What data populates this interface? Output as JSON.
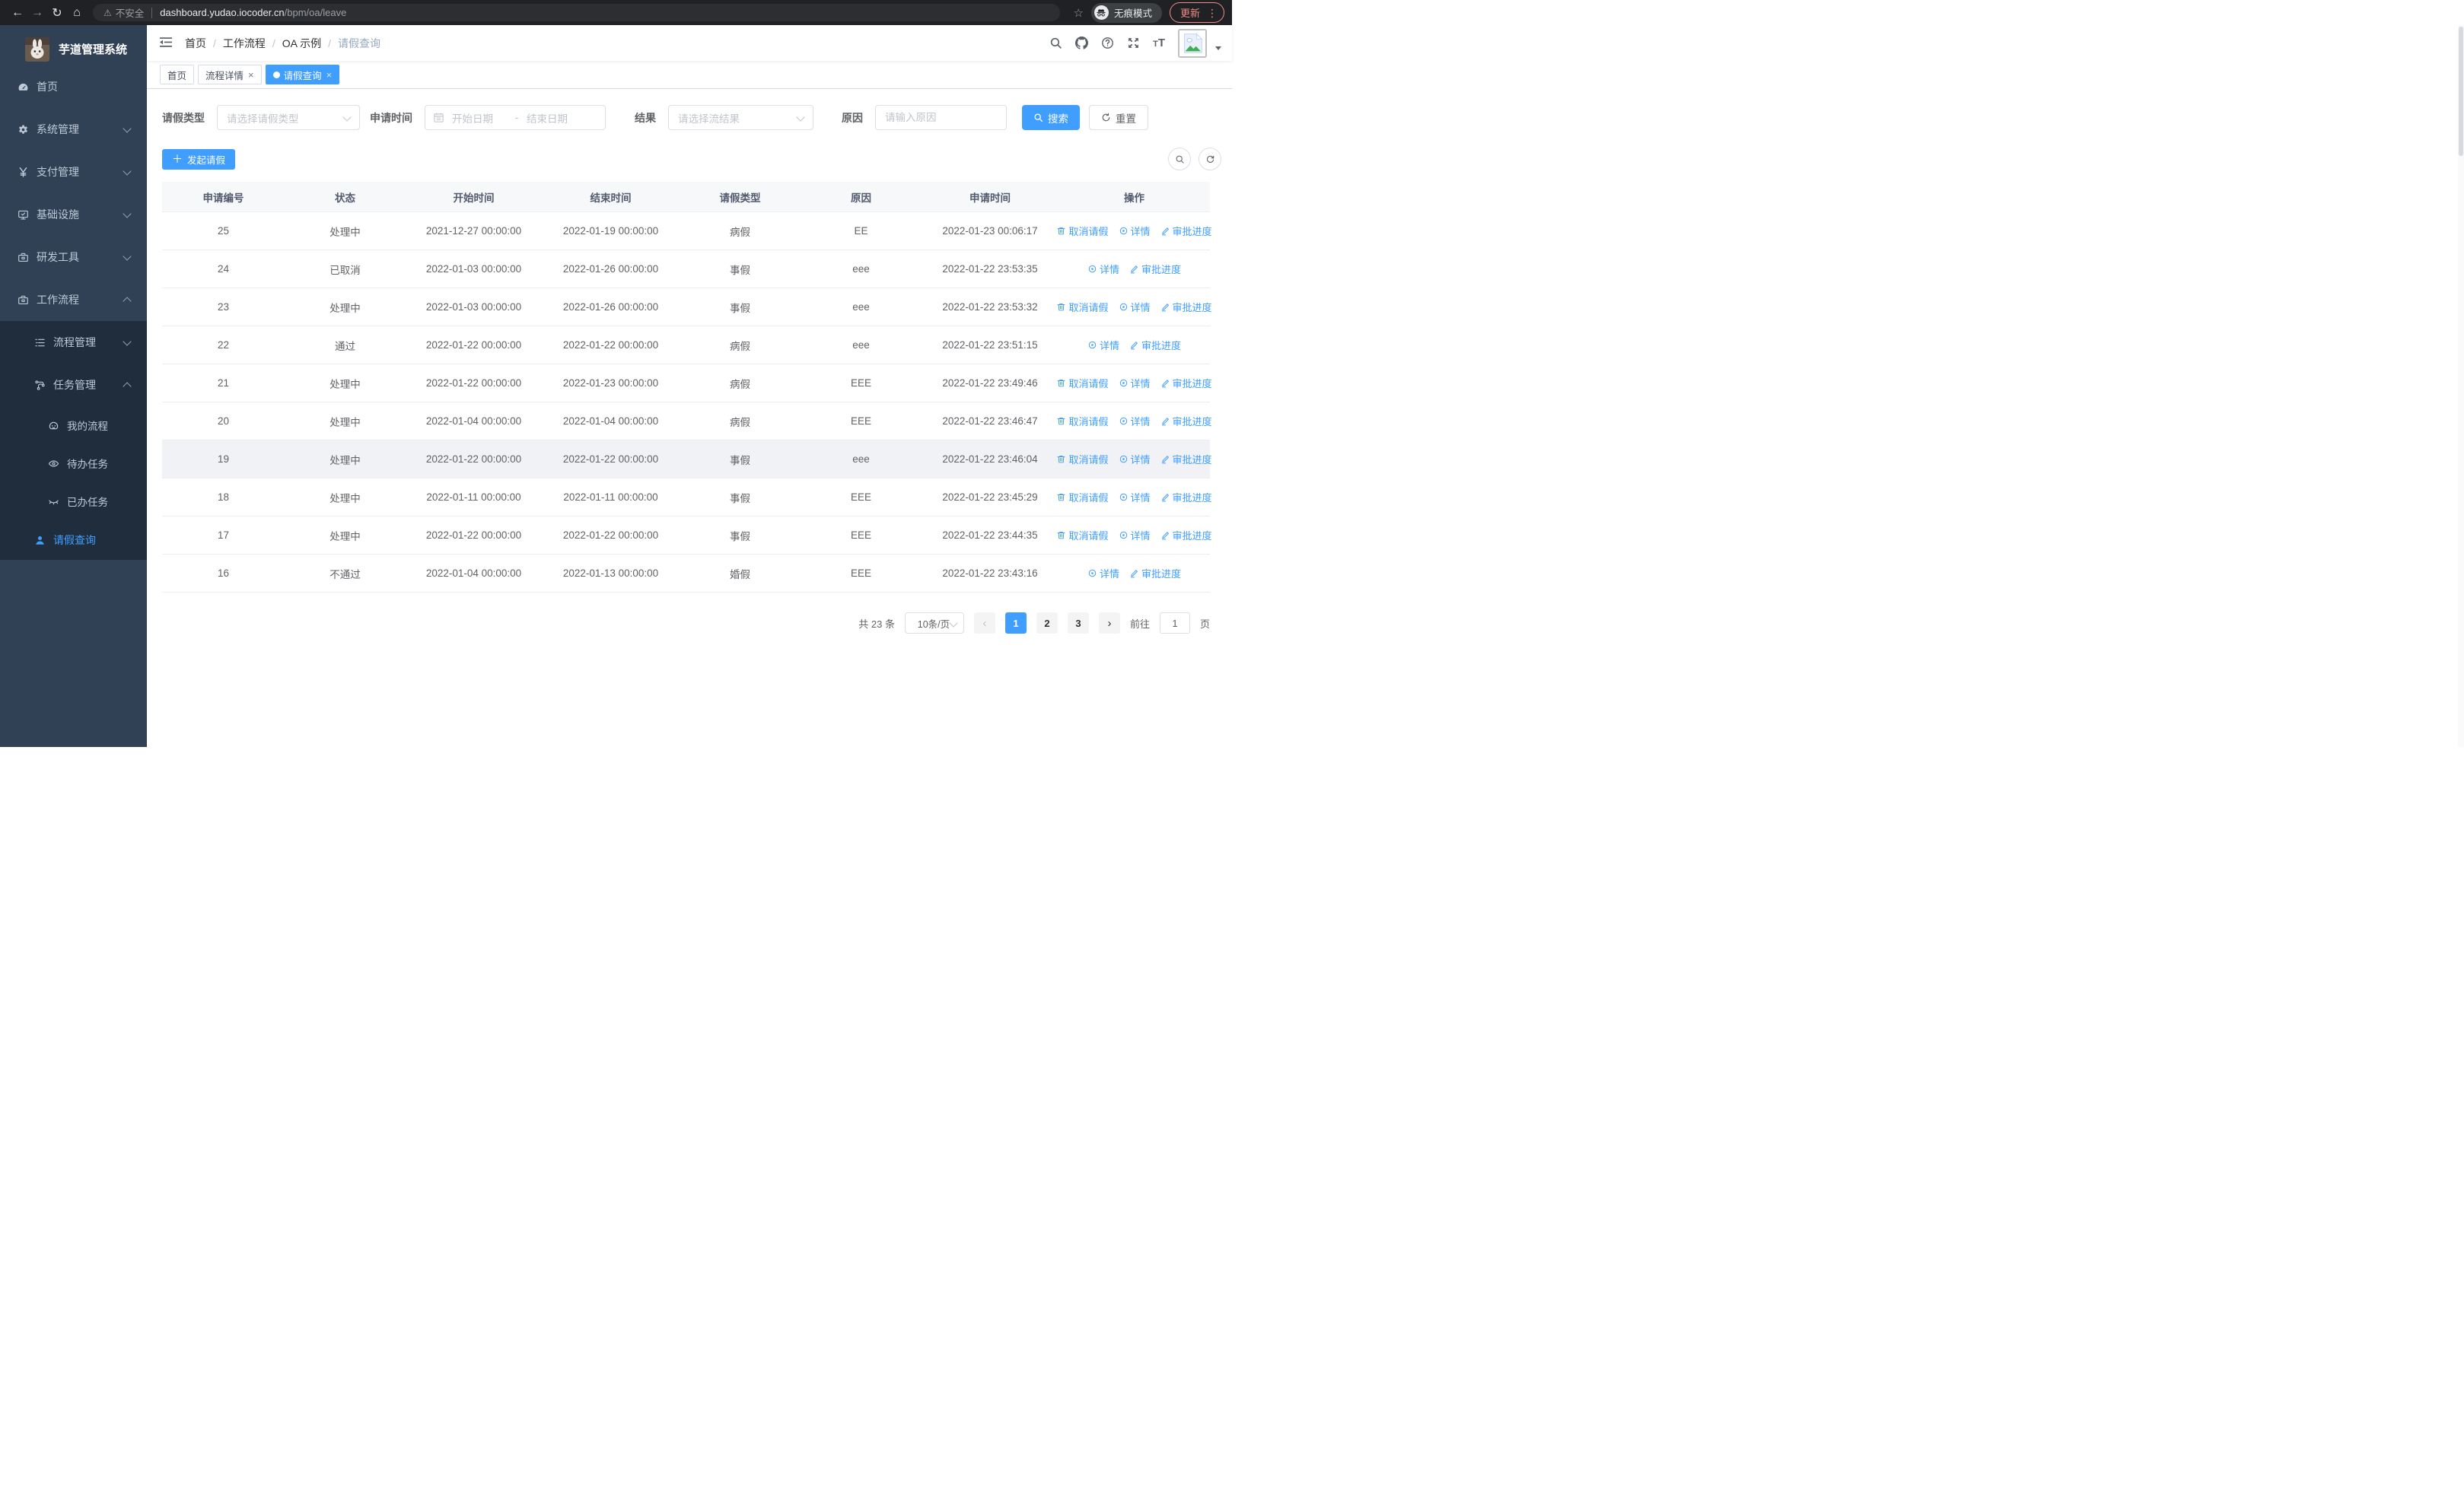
{
  "colors": {
    "accent": "#409eff",
    "sidebar_bg": "#304156",
    "submenu_bg": "#1f2d3d",
    "update": "#f28b82"
  },
  "browser": {
    "security_label": "不安全",
    "url_host": "dashboard.yudao.iocoder.cn",
    "url_path": "/bpm/oa/leave",
    "incognito_label": "无痕模式",
    "update_label": "更新"
  },
  "sidebar": {
    "title": "芋道管理系统",
    "menu": [
      {
        "key": "home",
        "label": "首页",
        "icon": "dashboard-icon",
        "level": 1
      },
      {
        "key": "system",
        "label": "系统管理",
        "icon": "gear-icon",
        "level": 1,
        "chevron": "down"
      },
      {
        "key": "payment",
        "label": "支付管理",
        "icon": "yen-icon",
        "level": 1,
        "chevron": "down"
      },
      {
        "key": "infrastructure",
        "label": "基础设施",
        "icon": "monitor-icon",
        "level": 1,
        "chevron": "down"
      },
      {
        "key": "dev-tools",
        "label": "研发工具",
        "icon": "toolbox-icon",
        "level": 1,
        "chevron": "down"
      },
      {
        "key": "workflow",
        "label": "工作流程",
        "icon": "workflow-icon",
        "level": 1,
        "chevron": "up"
      },
      {
        "key": "process-mgmt",
        "label": "流程管理",
        "icon": "list-icon",
        "level": 2,
        "chevron": "down",
        "submenu": true
      },
      {
        "key": "task-mgmt",
        "label": "任务管理",
        "icon": "branch-icon",
        "level": 2,
        "chevron": "up",
        "submenu": true
      },
      {
        "key": "my-process",
        "label": "我的流程",
        "icon": "robot-icon",
        "level": 3,
        "submenu": true
      },
      {
        "key": "todo-tasks",
        "label": "待办任务",
        "icon": "eye-icon",
        "level": 3,
        "submenu": true
      },
      {
        "key": "done-tasks",
        "label": "已办任务",
        "icon": "eye-closed-icon",
        "level": 3,
        "submenu": true
      },
      {
        "key": "leave-query",
        "label": "请假查询",
        "icon": "user-icon",
        "level": 2,
        "submenu": true,
        "active": true,
        "h52": true
      }
    ]
  },
  "header": {
    "breadcrumb": [
      "首页",
      "工作流程",
      "OA 示例",
      "请假查询"
    ],
    "icons": [
      "search-icon",
      "github-icon",
      "help-icon",
      "fullscreen-icon"
    ]
  },
  "tabs": [
    {
      "key": "home",
      "label": "首页",
      "closable": false,
      "active": false
    },
    {
      "key": "process-detail",
      "label": "流程详情",
      "closable": true,
      "active": false
    },
    {
      "key": "leave-query",
      "label": "请假查询",
      "closable": true,
      "active": true
    }
  ],
  "filters": {
    "type_label": "请假类型",
    "type_placeholder": "请选择请假类型",
    "time_label": "申请时间",
    "start_placeholder": "开始日期",
    "range_separator": "-",
    "end_placeholder": "结束日期",
    "result_label": "结果",
    "result_placeholder": "请选择流结果",
    "reason_label": "原因",
    "reason_placeholder": "请输入原因",
    "search_label": "搜索",
    "reset_label": "重置"
  },
  "toolbar": {
    "create_label": "发起请假"
  },
  "table": {
    "columns": [
      {
        "key": "id",
        "label": "申请编号",
        "w": 161
      },
      {
        "key": "status",
        "label": "状态",
        "w": 159
      },
      {
        "key": "start",
        "label": "开始时间",
        "w": 179
      },
      {
        "key": "end",
        "label": "结束时间",
        "w": 181
      },
      {
        "key": "type",
        "label": "请假类型",
        "w": 159
      },
      {
        "key": "reason",
        "label": "原因",
        "w": 159
      },
      {
        "key": "applied",
        "label": "申请时间",
        "w": 180
      },
      {
        "key": "ops",
        "label": "操作",
        "w": 199
      }
    ],
    "op_defs": {
      "cancel": {
        "label": "取消请假",
        "icon": "delete-icon"
      },
      "detail": {
        "label": "详情",
        "icon": "view-icon"
      },
      "progress": {
        "label": "审批进度",
        "icon": "edit-icon"
      }
    },
    "rows": [
      {
        "id": "25",
        "status": "处理中",
        "start": "2021-12-27 00:00:00",
        "end": "2022-01-19 00:00:00",
        "type": "病假",
        "reason": "EE",
        "applied": "2022-01-23 00:06:17",
        "ops": [
          "cancel",
          "detail",
          "progress"
        ]
      },
      {
        "id": "24",
        "status": "已取消",
        "start": "2022-01-03 00:00:00",
        "end": "2022-01-26 00:00:00",
        "type": "事假",
        "reason": "eee",
        "applied": "2022-01-22 23:53:35",
        "ops": [
          "detail",
          "progress"
        ]
      },
      {
        "id": "23",
        "status": "处理中",
        "start": "2022-01-03 00:00:00",
        "end": "2022-01-26 00:00:00",
        "type": "事假",
        "reason": "eee",
        "applied": "2022-01-22 23:53:32",
        "ops": [
          "cancel",
          "detail",
          "progress"
        ]
      },
      {
        "id": "22",
        "status": "通过",
        "start": "2022-01-22 00:00:00",
        "end": "2022-01-22 00:00:00",
        "type": "病假",
        "reason": "eee",
        "applied": "2022-01-22 23:51:15",
        "ops": [
          "detail",
          "progress"
        ]
      },
      {
        "id": "21",
        "status": "处理中",
        "start": "2022-01-22 00:00:00",
        "end": "2022-01-23 00:00:00",
        "type": "病假",
        "reason": "EEE",
        "applied": "2022-01-22 23:49:46",
        "ops": [
          "cancel",
          "detail",
          "progress"
        ]
      },
      {
        "id": "20",
        "status": "处理中",
        "start": "2022-01-04 00:00:00",
        "end": "2022-01-04 00:00:00",
        "type": "病假",
        "reason": "EEE",
        "applied": "2022-01-22 23:46:47",
        "ops": [
          "cancel",
          "detail",
          "progress"
        ]
      },
      {
        "id": "19",
        "status": "处理中",
        "start": "2022-01-22 00:00:00",
        "end": "2022-01-22 00:00:00",
        "type": "事假",
        "reason": "eee",
        "applied": "2022-01-22 23:46:04",
        "ops": [
          "cancel",
          "detail",
          "progress"
        ],
        "highlighted": true
      },
      {
        "id": "18",
        "status": "处理中",
        "start": "2022-01-11 00:00:00",
        "end": "2022-01-11 00:00:00",
        "type": "事假",
        "reason": "EEE",
        "applied": "2022-01-22 23:45:29",
        "ops": [
          "cancel",
          "detail",
          "progress"
        ]
      },
      {
        "id": "17",
        "status": "处理中",
        "start": "2022-01-22 00:00:00",
        "end": "2022-01-22 00:00:00",
        "type": "事假",
        "reason": "EEE",
        "applied": "2022-01-22 23:44:35",
        "ops": [
          "cancel",
          "detail",
          "progress"
        ]
      },
      {
        "id": "16",
        "status": "不通过",
        "start": "2022-01-04 00:00:00",
        "end": "2022-01-13 00:00:00",
        "type": "婚假",
        "reason": "EEE",
        "applied": "2022-01-22 23:43:16",
        "ops": [
          "detail",
          "progress"
        ]
      }
    ]
  },
  "pagination": {
    "total_label": "共 23 条",
    "size_label": "10条/页",
    "pages": [
      "1",
      "2",
      "3"
    ],
    "active_page": "1",
    "goto_label": "前往",
    "goto_value": "1",
    "unit_label": "页"
  }
}
